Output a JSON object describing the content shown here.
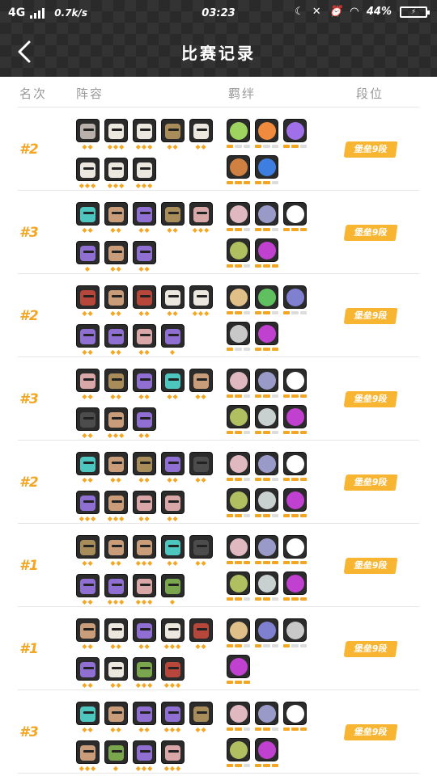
{
  "status_bar": {
    "network": "4G",
    "speed": "0.7k/s",
    "time": "03:23",
    "battery": "44%"
  },
  "nav": {
    "back_icon": "chevron-left-icon",
    "title": "比赛记录"
  },
  "columns": {
    "rank": "名次",
    "lineup": "阵容",
    "synergy": "羁绊",
    "tier": "段位"
  },
  "colors": {
    "accent": "#f2a623",
    "badge": "#f7b531",
    "topbar": "#2a2a2a"
  },
  "matches": [
    {
      "rank": "#2",
      "tier": "堡垒9段",
      "units": [
        [
          "gray",
          2
        ],
        [
          "white",
          3
        ],
        [
          "white",
          3
        ],
        [
          "gold",
          2
        ],
        [
          "white",
          2
        ],
        [
          "white",
          3
        ],
        [
          "white",
          3
        ],
        [
          "white",
          3
        ]
      ],
      "synergies": [
        {
          "icon": "crossed-swords-icon",
          "tint": "#9fd35f",
          "level": [
            1,
            0,
            0
          ]
        },
        {
          "icon": "feather-icon",
          "tint": "#f08a3c",
          "level": [
            1,
            0,
            0
          ]
        },
        {
          "icon": "moon-icon",
          "tint": "#a070e8",
          "level": [
            1,
            1,
            0
          ]
        },
        {
          "icon": "demon-icon",
          "tint": "#d08040",
          "level": [
            1,
            1,
            1
          ]
        },
        {
          "icon": "dragon-icon",
          "tint": "#3d7ee0",
          "level": [
            1,
            1,
            0
          ]
        }
      ]
    },
    {
      "rank": "#3",
      "tier": "堡垒9段",
      "units": [
        [
          "teal",
          2
        ],
        [
          "tan",
          2
        ],
        [
          "purple",
          2
        ],
        [
          "gold",
          2
        ],
        [
          "pink",
          3
        ],
        [
          "purple",
          1
        ],
        [
          "tan",
          2
        ],
        [
          "purple",
          2
        ]
      ],
      "synergies": [
        {
          "icon": "knight-icon",
          "tint": "#e0b8c0",
          "level": [
            1,
            1,
            0
          ]
        },
        {
          "icon": "mech-icon",
          "tint": "#9a9ac8",
          "level": [
            1,
            1,
            0
          ]
        },
        {
          "icon": "plus-icon",
          "tint": "#ffffff",
          "level": [
            1,
            1,
            1
          ]
        },
        {
          "icon": "cave-icon",
          "tint": "#b0c060",
          "level": [
            1,
            1,
            0
          ]
        },
        {
          "icon": "demon-face-icon",
          "tint": "#c040d0",
          "level": [
            1,
            1,
            1
          ]
        }
      ]
    },
    {
      "rank": "#2",
      "tier": "堡垒9段",
      "units": [
        [
          "red",
          2
        ],
        [
          "tan",
          2
        ],
        [
          "red",
          2
        ],
        [
          "white",
          2
        ],
        [
          "white",
          3
        ],
        [
          "purple",
          2
        ],
        [
          "purple",
          2
        ],
        [
          "pink",
          2
        ],
        [
          "purple",
          1
        ]
      ],
      "synergies": [
        {
          "icon": "axe-icon",
          "tint": "#e0c088",
          "level": [
            1,
            1,
            0
          ]
        },
        {
          "icon": "paw-icon",
          "tint": "#60c060",
          "level": [
            1,
            1,
            0
          ]
        },
        {
          "icon": "fish-icon",
          "tint": "#8080d0",
          "level": [
            1,
            0,
            0
          ]
        },
        {
          "icon": "helmet-icon",
          "tint": "#c8c8c8",
          "level": [
            1,
            0,
            0
          ]
        },
        {
          "icon": "demon-face-icon",
          "tint": "#c040d0",
          "level": [
            1,
            1,
            1
          ]
        }
      ]
    },
    {
      "rank": "#3",
      "tier": "堡垒9段",
      "units": [
        [
          "pink",
          2
        ],
        [
          "gold",
          2
        ],
        [
          "purple",
          2
        ],
        [
          "teal",
          2
        ],
        [
          "tan",
          2
        ],
        [
          "dark",
          2
        ],
        [
          "tan",
          3
        ],
        [
          "purple",
          2
        ]
      ],
      "synergies": [
        {
          "icon": "knight-icon",
          "tint": "#e0b8c0",
          "level": [
            1,
            1,
            0
          ]
        },
        {
          "icon": "mech-icon",
          "tint": "#9a9ac8",
          "level": [
            1,
            1,
            0
          ]
        },
        {
          "icon": "plus-icon",
          "tint": "#ffffff",
          "level": [
            1,
            1,
            1
          ]
        },
        {
          "icon": "cave-icon",
          "tint": "#b0c060",
          "level": [
            1,
            1,
            0
          ]
        },
        {
          "icon": "skull-icon",
          "tint": "#c8d0d0",
          "level": [
            1,
            1,
            0
          ]
        },
        {
          "icon": "demon-face-icon",
          "tint": "#c040d0",
          "level": [
            1,
            1,
            1
          ]
        }
      ]
    },
    {
      "rank": "#2",
      "tier": "堡垒9段",
      "units": [
        [
          "teal",
          2
        ],
        [
          "tan",
          2
        ],
        [
          "gold",
          2
        ],
        [
          "purple",
          2
        ],
        [
          "dark",
          2
        ],
        [
          "purple",
          3
        ],
        [
          "tan",
          3
        ],
        [
          "pink",
          2
        ],
        [
          "pink",
          2
        ]
      ],
      "synergies": [
        {
          "icon": "knight-icon",
          "tint": "#e0b8c0",
          "level": [
            1,
            1,
            0
          ]
        },
        {
          "icon": "mech-icon",
          "tint": "#9a9ac8",
          "level": [
            1,
            1,
            0
          ]
        },
        {
          "icon": "plus-icon",
          "tint": "#ffffff",
          "level": [
            1,
            1,
            1
          ]
        },
        {
          "icon": "cave-icon",
          "tint": "#b0c060",
          "level": [
            1,
            1,
            0
          ]
        },
        {
          "icon": "skull-icon",
          "tint": "#c8d0d0",
          "level": [
            1,
            1,
            0
          ]
        },
        {
          "icon": "demon-face-icon",
          "tint": "#c040d0",
          "level": [
            1,
            1,
            1
          ]
        }
      ]
    },
    {
      "rank": "#1",
      "tier": "堡垒9段",
      "units": [
        [
          "gold",
          2
        ],
        [
          "tan",
          2
        ],
        [
          "tan",
          3
        ],
        [
          "teal",
          2
        ],
        [
          "dark",
          2
        ],
        [
          "purple",
          2
        ],
        [
          "purple",
          3
        ],
        [
          "pink",
          3
        ],
        [
          "green",
          1
        ]
      ],
      "synergies": [
        {
          "icon": "knight-icon",
          "tint": "#e0b8c0",
          "level": [
            1,
            1,
            1
          ]
        },
        {
          "icon": "mech-icon",
          "tint": "#9a9ac8",
          "level": [
            1,
            1,
            1
          ]
        },
        {
          "icon": "plus-icon",
          "tint": "#ffffff",
          "level": [
            1,
            1,
            1
          ]
        },
        {
          "icon": "cave-icon",
          "tint": "#b0c060",
          "level": [
            1,
            1,
            0
          ]
        },
        {
          "icon": "skull-icon",
          "tint": "#c8d0d0",
          "level": [
            1,
            1,
            0
          ]
        },
        {
          "icon": "demon-face-icon",
          "tint": "#c040d0",
          "level": [
            1,
            1,
            1
          ]
        }
      ]
    },
    {
      "rank": "#1",
      "tier": "堡垒9段",
      "units": [
        [
          "tan",
          2
        ],
        [
          "white",
          2
        ],
        [
          "purple",
          2
        ],
        [
          "white",
          3
        ],
        [
          "red",
          2
        ],
        [
          "purple",
          2
        ],
        [
          "white",
          2
        ],
        [
          "green",
          3
        ],
        [
          "red",
          3
        ]
      ],
      "synergies": [
        {
          "icon": "axe-icon",
          "tint": "#e0c088",
          "level": [
            1,
            1,
            0
          ]
        },
        {
          "icon": "fish-icon",
          "tint": "#8080d0",
          "level": [
            1,
            0,
            0
          ]
        },
        {
          "icon": "helmet-icon",
          "tint": "#c8c8c8",
          "level": [
            1,
            0,
            0
          ]
        },
        {
          "icon": "demon-face-icon",
          "tint": "#c040d0",
          "level": [
            1,
            1,
            1
          ]
        }
      ]
    },
    {
      "rank": "#3",
      "tier": "堡垒9段",
      "units": [
        [
          "teal",
          2
        ],
        [
          "tan",
          2
        ],
        [
          "purple",
          2
        ],
        [
          "purple",
          3
        ],
        [
          "gold",
          2
        ],
        [
          "tan",
          3
        ],
        [
          "green",
          1
        ],
        [
          "purple",
          3
        ],
        [
          "pink",
          3
        ]
      ],
      "synergies": [
        {
          "icon": "knight-icon",
          "tint": "#e0b8c0",
          "level": [
            1,
            1,
            0
          ]
        },
        {
          "icon": "mech-icon",
          "tint": "#9a9ac8",
          "level": [
            1,
            1,
            0
          ]
        },
        {
          "icon": "plus-icon",
          "tint": "#ffffff",
          "level": [
            1,
            1,
            1
          ]
        },
        {
          "icon": "cave-icon",
          "tint": "#b0c060",
          "level": [
            1,
            1,
            0
          ]
        },
        {
          "icon": "demon-face-icon",
          "tint": "#c040d0",
          "level": [
            1,
            1,
            1
          ]
        }
      ]
    }
  ]
}
